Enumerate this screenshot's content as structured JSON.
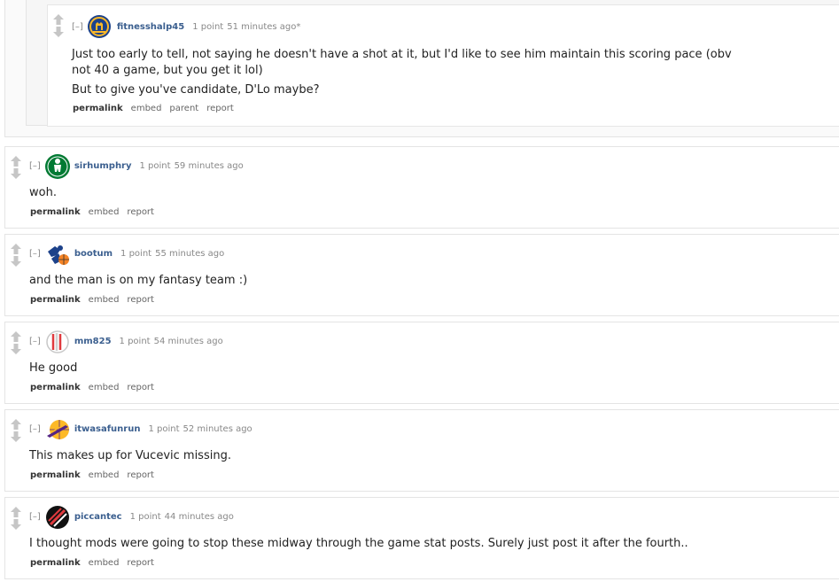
{
  "ui": {
    "expand_label": "[–]"
  },
  "parent_comment": {
    "author": "fitnesshalp45",
    "score": "1 point",
    "time": "51 minutes ago*",
    "flair_icon": "warriors-logo-icon",
    "paragraphs": [
      "Just too early to tell, not saying he doesn't have a shot at it, but I'd like to see him maintain this scoring pace (obv not 40 a game, but you get it lol)",
      "But to give you've candidate, D'Lo maybe?"
    ],
    "buttons": [
      "permalink",
      "embed",
      "parent",
      "report"
    ]
  },
  "comments": [
    {
      "author": "sirhumphry",
      "score": "1 point",
      "time": "59 minutes ago",
      "flair_icon": "celtics-logo-icon",
      "text": "woh.",
      "buttons": [
        "permalink",
        "embed",
        "report"
      ]
    },
    {
      "author": "bootum",
      "score": "1 point",
      "time": "55 minutes ago",
      "flair_icon": "knicks-logo-icon",
      "text": "and the man is on my fantasy team :)",
      "buttons": [
        "permalink",
        "embed",
        "report"
      ]
    },
    {
      "author": "mm825",
      "score": "1 point",
      "time": "54 minutes ago",
      "flair_icon": "blazers-logo-icon",
      "text": "He good",
      "buttons": [
        "permalink",
        "embed",
        "report"
      ]
    },
    {
      "author": "itwasafunrun",
      "score": "1 point",
      "time": "52 minutes ago",
      "flair_icon": "lakers-logo-icon",
      "text": "This makes up for Vucevic missing.",
      "buttons": [
        "permalink",
        "embed",
        "report"
      ]
    },
    {
      "author": "piccantec",
      "score": "1 point",
      "time": "44 minutes ago",
      "flair_icon": "blazers-logo-icon",
      "text": "I thought mods were going to stop these midway through the game stat posts. Surely just post it after the fourth..",
      "buttons": [
        "permalink",
        "embed",
        "report"
      ]
    }
  ],
  "colors": {
    "author": "#3b5f8f",
    "meta": "#888888",
    "arrow": "#c6c6c6"
  }
}
